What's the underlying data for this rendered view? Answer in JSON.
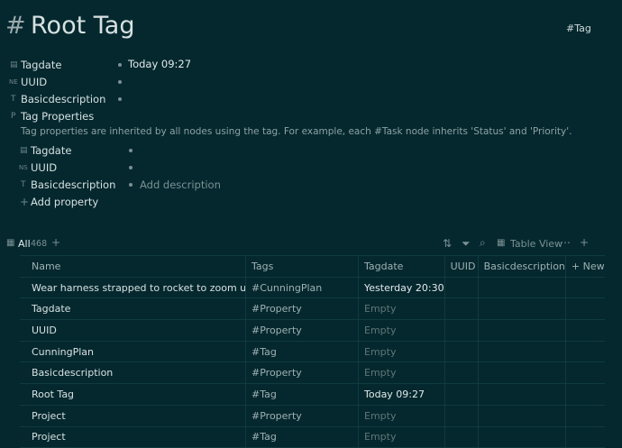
{
  "header": {
    "hash": "#",
    "title": "Root Tag",
    "tag_badge": "#Tag"
  },
  "fields": [
    {
      "icon": "calendar-icon",
      "glyph": "▤",
      "label": "Tagdate",
      "value": "Today 09:27"
    },
    {
      "icon": "number-icon",
      "glyph": "NE",
      "label": "UUID",
      "value": ""
    },
    {
      "icon": "text-icon",
      "glyph": "T",
      "label": "Basicdescription",
      "value": ""
    },
    {
      "icon": "text-icon",
      "glyph": "P",
      "label": "Tag Properties",
      "value": ""
    }
  ],
  "tag_properties": {
    "description": "Tag properties are inherited by all nodes using the tag. For example, each #Task node inherits 'Status' and 'Priority'.",
    "items": [
      {
        "icon": "calendar-icon",
        "glyph": "▤",
        "label": "Tagdate",
        "value": ""
      },
      {
        "icon": "number-icon",
        "glyph": "NS",
        "label": "UUID",
        "value": ""
      },
      {
        "icon": "text-icon",
        "glyph": "T",
        "label": "Basicdescription",
        "value": "Add description"
      }
    ],
    "add_property": "Add property"
  },
  "view_bar": {
    "tab_label": "All",
    "tab_count": "468",
    "view_label": "Table View"
  },
  "table": {
    "columns": [
      "Name",
      "Tags",
      "Tagdate",
      "UUID",
      "Basicdescription",
      "New"
    ],
    "rows": [
      {
        "name": "Wear harness strapped to rocket to zoom up on Roa",
        "tags": "#CunningPlan",
        "tagdate": "Yesterday 20:30",
        "set": true
      },
      {
        "name": "Tagdate",
        "tags": "#Property",
        "tagdate": "Empty",
        "set": false
      },
      {
        "name": "UUID",
        "tags": "#Property",
        "tagdate": "Empty",
        "set": false
      },
      {
        "name": "CunningPlan",
        "tags": "#Tag",
        "tagdate": "Empty",
        "set": false
      },
      {
        "name": "Basicdescription",
        "tags": "#Property",
        "tagdate": "Empty",
        "set": false
      },
      {
        "name": "Root Tag",
        "tags": "#Tag",
        "tagdate": "Today 09:27",
        "set": true
      },
      {
        "name": "Project",
        "tags": "#Property",
        "tagdate": "Empty",
        "set": false
      },
      {
        "name": "Project",
        "tags": "#Tag",
        "tagdate": "Empty",
        "set": false
      }
    ]
  }
}
